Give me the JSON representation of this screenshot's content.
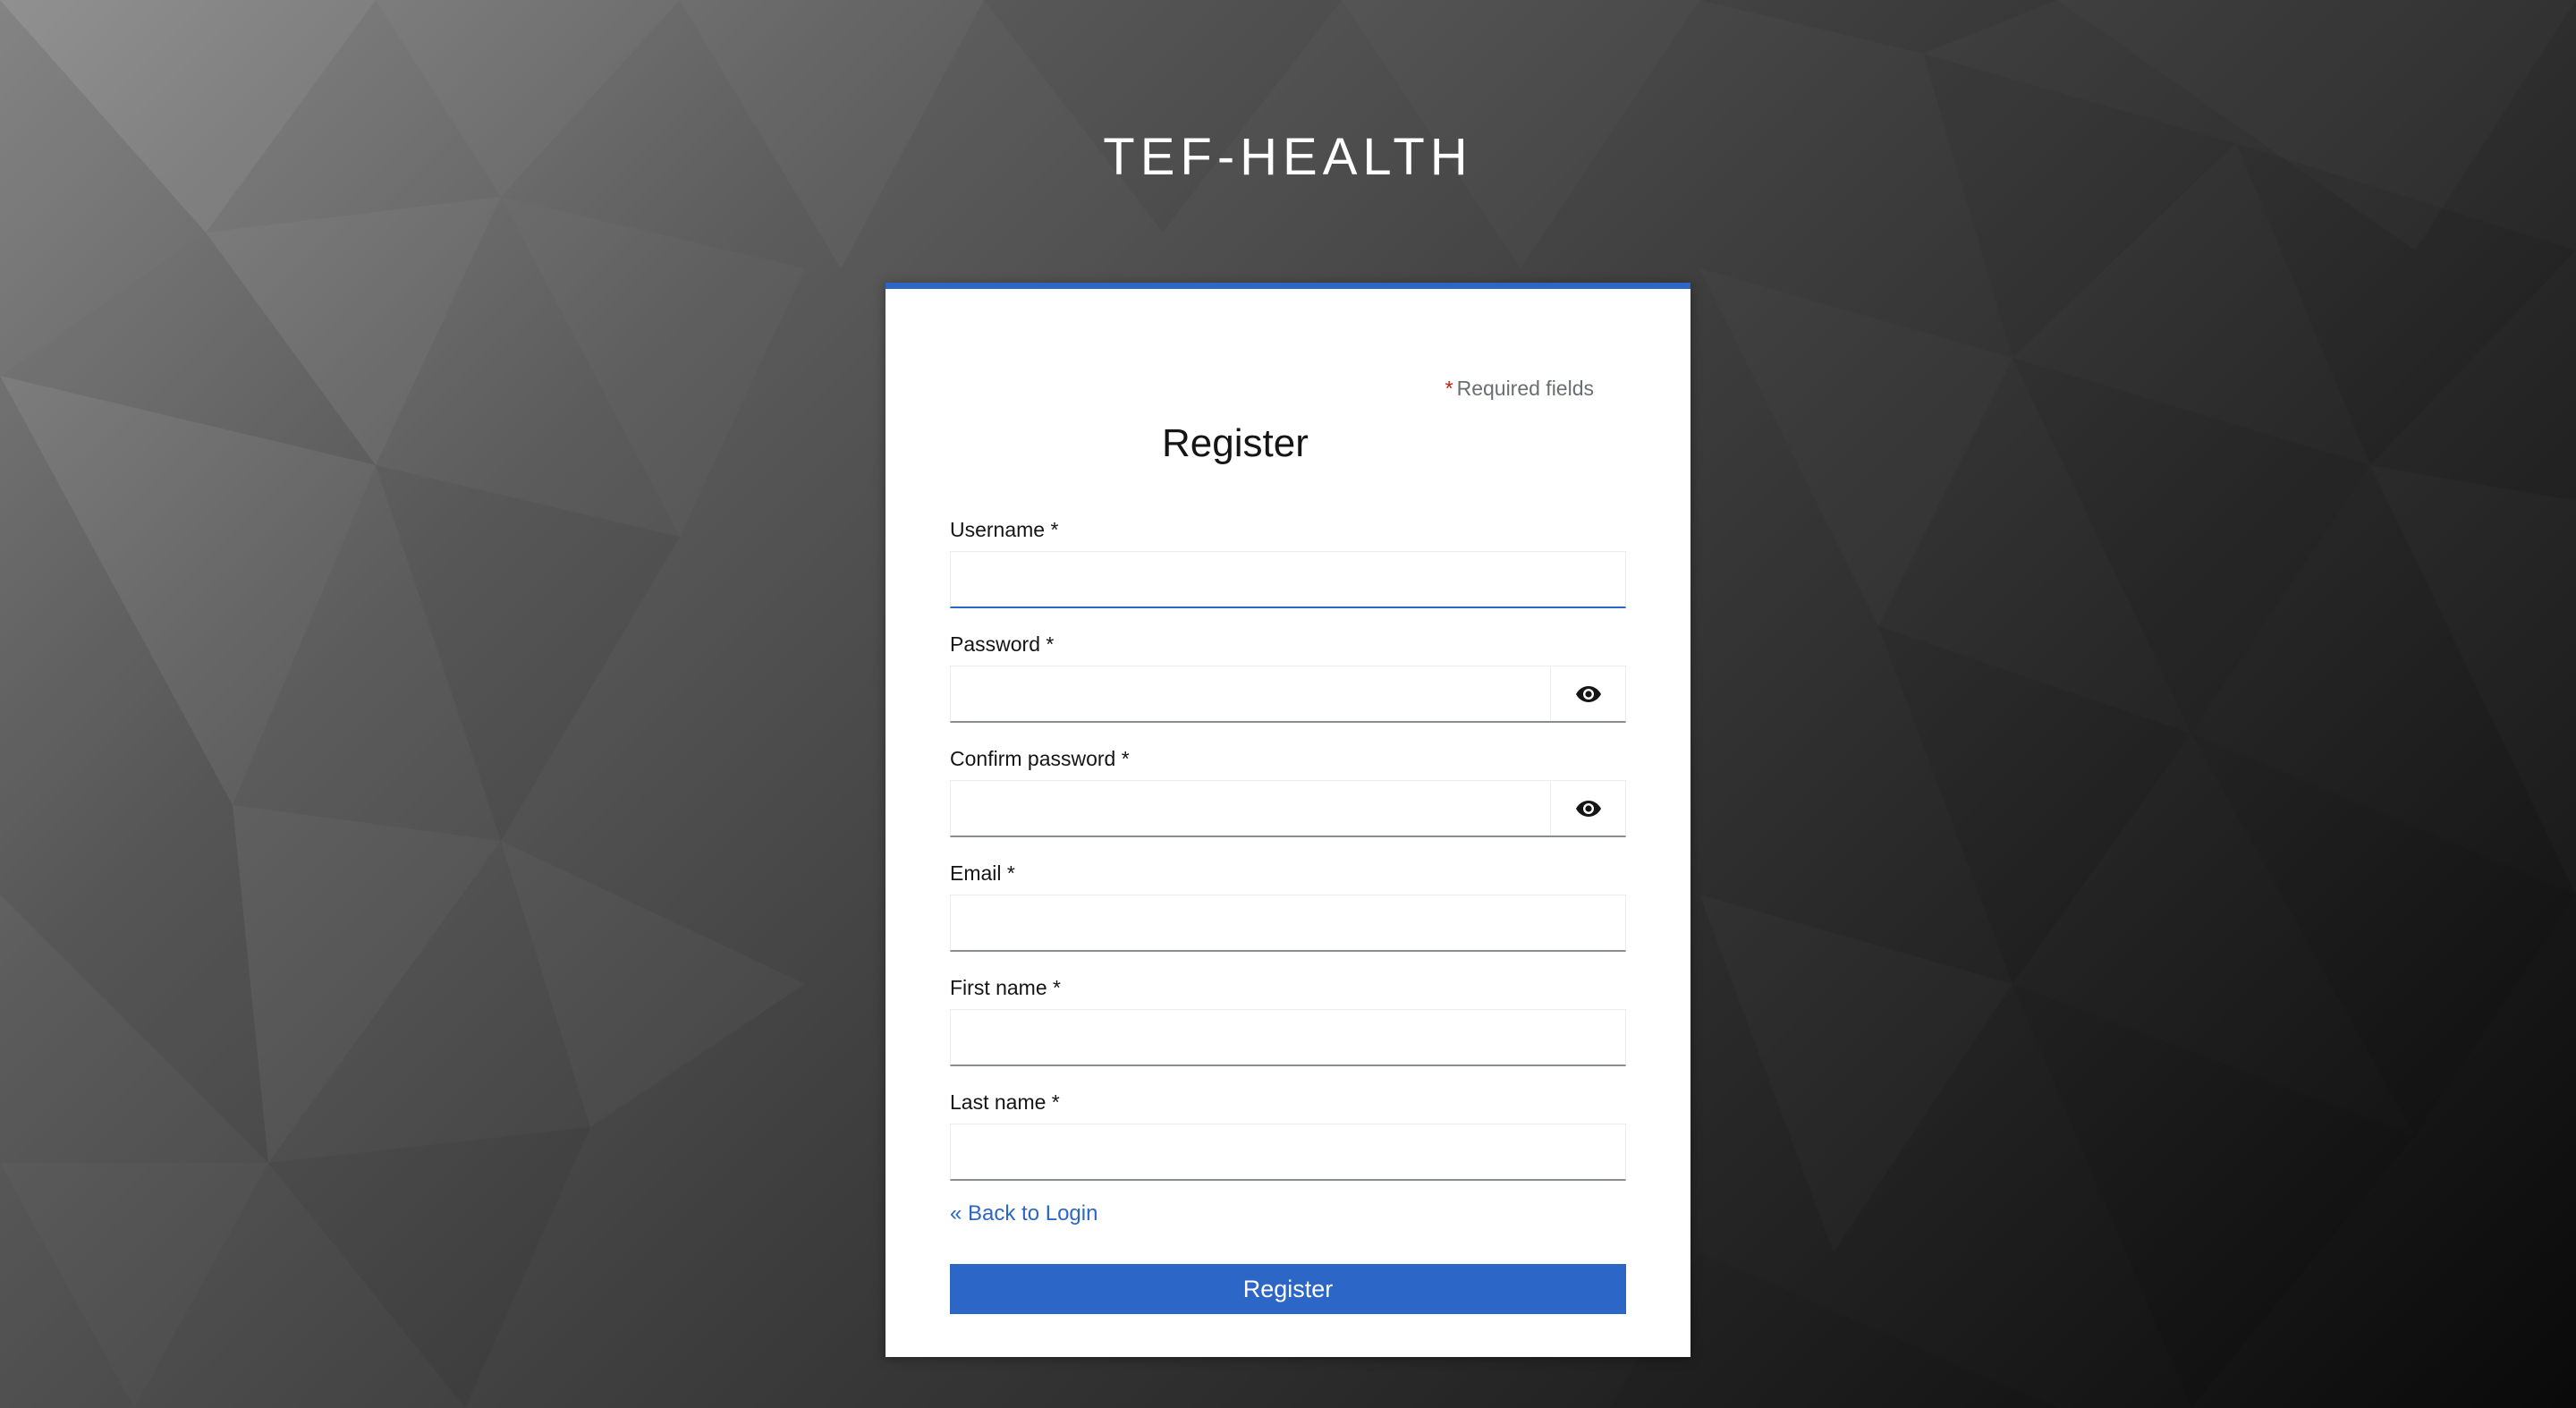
{
  "brand": {
    "title": "TEF-HEALTH"
  },
  "form": {
    "required_marker": "*",
    "required_note": "Required fields",
    "title": "Register",
    "fields": [
      {
        "label": "Username *",
        "value": "",
        "type": "text",
        "has_toggle": false,
        "focused": true
      },
      {
        "label": "Password *",
        "value": "",
        "type": "password",
        "has_toggle": true,
        "focused": false
      },
      {
        "label": "Confirm password *",
        "value": "",
        "type": "password",
        "has_toggle": true,
        "focused": false
      },
      {
        "label": "Email *",
        "value": "",
        "type": "text",
        "has_toggle": false,
        "focused": false
      },
      {
        "label": "First name *",
        "value": "",
        "type": "text",
        "has_toggle": false,
        "focused": false
      },
      {
        "label": "Last name *",
        "value": "",
        "type": "text",
        "has_toggle": false,
        "focused": false
      }
    ],
    "back_link": "« Back to Login",
    "submit_label": "Register"
  },
  "icons": {
    "password_toggle": "eye-icon"
  },
  "colors": {
    "accent": "#2c66c6",
    "required_star": "#c9190b",
    "background_dark": "#0a0a0a",
    "background_light": "#8a8a8a"
  }
}
